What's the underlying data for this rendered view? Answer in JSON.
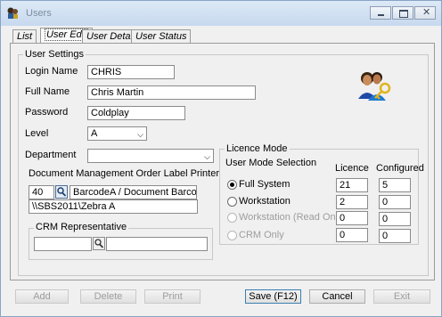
{
  "window": {
    "title": "Users"
  },
  "tabs": [
    {
      "label": "List"
    },
    {
      "label": "User Edit"
    },
    {
      "label": "User Details"
    },
    {
      "label": "User Status"
    }
  ],
  "user_settings": {
    "legend": "User Settings",
    "login_name_label": "Login Name",
    "login_name_value": "CHRIS",
    "full_name_label": "Full Name",
    "full_name_value": "Chris Martin",
    "password_label": "Password",
    "password_value": "Coldplay",
    "level_label": "Level",
    "level_value": "A",
    "department_label": "Department",
    "department_value": "",
    "doc_mgmt_label": "Document Management Order Label Printer",
    "doc_printer_code": "40",
    "doc_printer_name": "BarcodeA  / Document Barcode",
    "doc_printer_path": "\\\\SBS2011\\Zebra A",
    "crm_legend": "CRM Representative",
    "crm_code": "",
    "crm_name": ""
  },
  "licence_mode": {
    "legend": "Licence Mode",
    "selection_label": "User Mode Selection",
    "licence_header": "Licence",
    "configured_header": "Configured",
    "rows": [
      {
        "label": "Full System",
        "licence": "21",
        "configured": "5"
      },
      {
        "label": "Workstation",
        "licence": "2",
        "configured": "0"
      },
      {
        "label": "Workstation (Read Only)",
        "licence": "0",
        "configured": "0"
      },
      {
        "label": "CRM Only",
        "licence": "0",
        "configured": "0"
      }
    ],
    "selected": "Full System"
  },
  "buttons": {
    "add": "Add",
    "delete": "Delete",
    "print": "Print",
    "save": "Save (F12)",
    "cancel": "Cancel",
    "exit": "Exit"
  },
  "icons": {
    "app": "users-app-icon",
    "user_keys": "user-keys-icon"
  }
}
